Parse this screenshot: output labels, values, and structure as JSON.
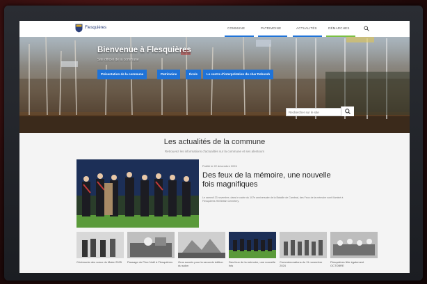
{
  "header": {
    "site_name": "Flesquières",
    "nav": [
      "COMMUNE",
      "PATRIMOINE",
      "ACTUALITÉS",
      "DÉMARCHES"
    ],
    "nav_underline_colors": [
      "#1f73d8",
      "#1f73d8",
      "#1f73d8",
      "#7bc043"
    ]
  },
  "hero": {
    "title": "Bienvenue à Flesquières",
    "subtitle": "Site officiel de la commune",
    "buttons": [
      "Présentation de la commune",
      "Patrimoine",
      "École",
      "Le centre d'interprétation du char Deborah"
    ],
    "search_placeholder": "Rechercher sur le site"
  },
  "news": {
    "title": "Les actualités de la commune",
    "subtitle": "Retrouvez les informations d'actualités sur la commune et ses alentours",
    "featured": {
      "date": "Publié le 22 décembre 2024",
      "title": "Des feux de la mémoire, une nouvelle fois magnifiques",
      "excerpt": "Le samedi 23 novembre, dans le cadre du 107e anniversaire de la Bataille de Cambrai, des Feux de la mémoire sont illuminé à Flesquières Hill British Cemetery."
    },
    "cards": [
      {
        "caption": "Cérémonie des vœux du Maire 2025"
      },
      {
        "caption": "Passage du Père Noël à Flesquières"
      },
      {
        "caption": "Gros succès pour la seconde édition du salon"
      },
      {
        "caption": "Des feux de la mémoire, une nouvelle fois"
      },
      {
        "caption": "Commémorations du 11 novembre 2024"
      },
      {
        "caption": "Flesquières fête également OCTOBRE"
      }
    ]
  },
  "colors": {
    "accent": "#1f73d8",
    "brand": "#2b3f7a"
  }
}
